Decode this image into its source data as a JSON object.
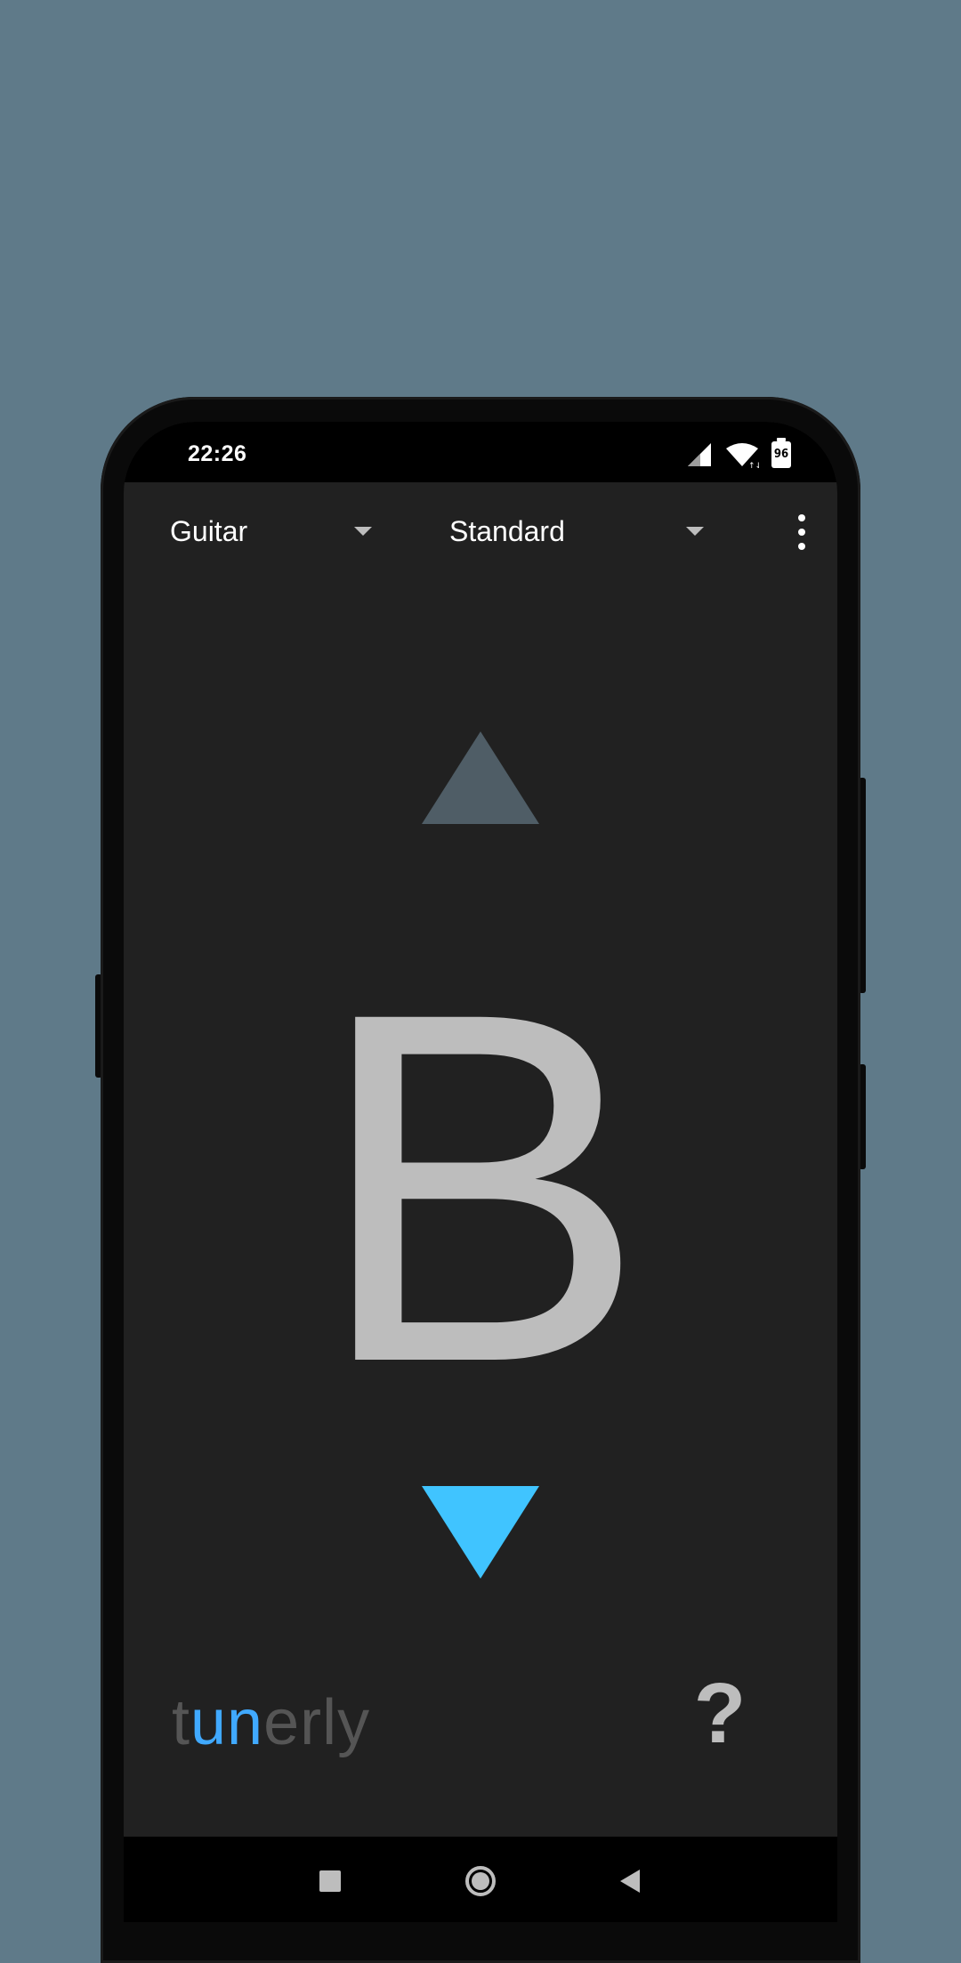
{
  "status_bar": {
    "time": "22:26",
    "battery_level": "96",
    "icons": [
      "signal-icon",
      "wifi-icon",
      "battery-icon"
    ]
  },
  "toolbar": {
    "instrument": "Guitar",
    "tuning": "Standard",
    "menu_icon": "overflow-menu-icon"
  },
  "tuner": {
    "note": "B",
    "sharp_indicator_icon": "arrow-up-icon",
    "flat_indicator_icon": "arrow-down-icon",
    "active_indicator": "down",
    "colors": {
      "inactive_arrow": "#4f5d66",
      "active_arrow": "#40c4ff",
      "note": "#bdbdbd"
    }
  },
  "footer": {
    "logo_part1": "t",
    "logo_part2": "un",
    "logo_part3": "erly",
    "help_label": "?"
  },
  "nav_bar": {
    "icons": [
      "recents-icon",
      "home-icon",
      "back-icon"
    ]
  },
  "colors": {
    "background": "#5f7a89",
    "app_background": "#212121",
    "accent": "#40c4ff"
  }
}
